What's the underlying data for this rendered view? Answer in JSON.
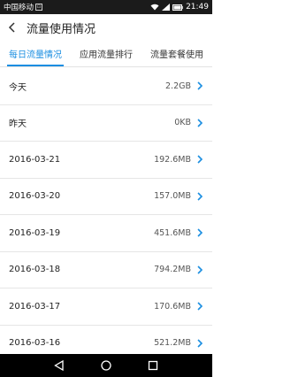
{
  "status_bar": {
    "carrier": "中国移动",
    "sim_icon": "sim-icon",
    "time": "21:49",
    "icons": [
      "wifi-icon",
      "signal-icon",
      "battery-icon"
    ]
  },
  "header": {
    "title": "流量使用情况"
  },
  "tabs": [
    {
      "label": "每日流量情况",
      "active": true
    },
    {
      "label": "应用流量排行",
      "active": false
    },
    {
      "label": "流量套餐使用",
      "active": false
    }
  ],
  "rows": [
    {
      "label": "今天",
      "value": "2.2GB"
    },
    {
      "label": "昨天",
      "value": "0KB"
    },
    {
      "label": "2016-03-21",
      "value": "192.6MB"
    },
    {
      "label": "2016-03-20",
      "value": "157.0MB"
    },
    {
      "label": "2016-03-19",
      "value": "451.6MB"
    },
    {
      "label": "2016-03-18",
      "value": "794.2MB"
    },
    {
      "label": "2016-03-17",
      "value": "170.6MB"
    },
    {
      "label": "2016-03-16",
      "value": "521.2MB"
    }
  ],
  "colors": {
    "accent": "#1a8ee1",
    "status_bar": "#1b1b1b",
    "nav_bar": "#000000"
  }
}
